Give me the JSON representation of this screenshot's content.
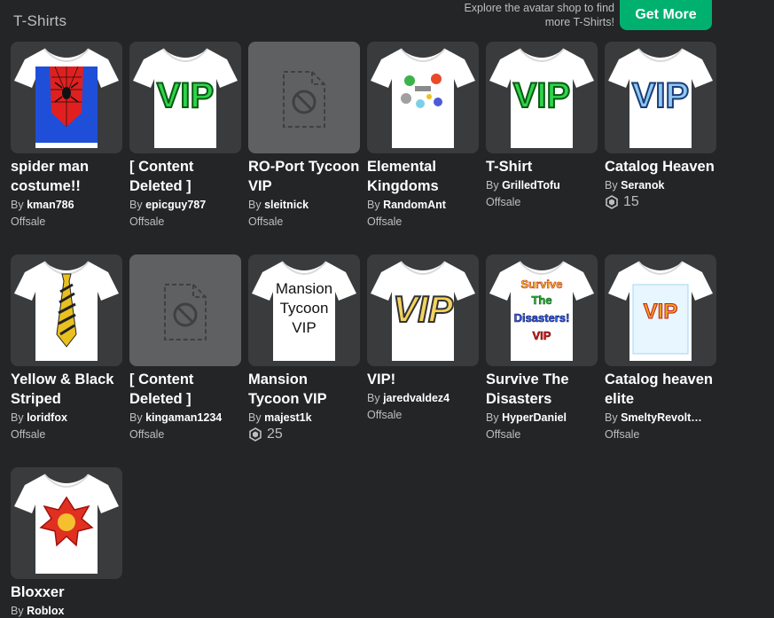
{
  "header": {
    "category_title": "T-Shirts",
    "promo_line1": "Explore the avatar shop to find",
    "promo_line2": "more T-Shirts!",
    "get_more_label": "Get More",
    "accent_color": "#00b06f"
  },
  "items": [
    {
      "name": "spider man costume!!",
      "by": "By",
      "creator": "kman786",
      "price": "Offsale",
      "thumb": "spiderman-shirt"
    },
    {
      "name": "[ Content Deleted ]",
      "by": "By",
      "creator": "epicguy787",
      "price": "Offsale",
      "thumb": "vip-green-shirt"
    },
    {
      "name": "RO-Port Tycoon VIP",
      "by": "By",
      "creator": "sleitnick",
      "price": "Offsale",
      "thumb": "deleted-placeholder"
    },
    {
      "name": "Elemental Kingdoms",
      "by": "By",
      "creator": "RandomAnt",
      "price": "Offsale",
      "thumb": "elemental-shirt"
    },
    {
      "name": "T-Shirt",
      "by": "By",
      "creator": "GrilledTofu",
      "price": "Offsale",
      "thumb": "vip-green-shirt"
    },
    {
      "name": "Catalog Heaven",
      "by": "By",
      "creator": "Seranok",
      "price": "15",
      "price_type": "robux",
      "thumb": "vip-sky-shirt"
    },
    {
      "name": "Yellow & Black Striped",
      "by": "By",
      "creator": "loridfox",
      "price": "Offsale",
      "thumb": "tie-shirt"
    },
    {
      "name": "[ Content Deleted ]",
      "by": "By",
      "creator": "kingaman1234",
      "price": "Offsale",
      "thumb": "deleted-placeholder"
    },
    {
      "name": "Mansion Tycoon VIP",
      "by": "By",
      "creator": "majest1k",
      "price": "25",
      "price_type": "robux",
      "thumb": "mansion-shirt"
    },
    {
      "name": "VIP!",
      "by": "By",
      "creator": "jaredvaldez4",
      "price": "Offsale",
      "thumb": "vip-gold-shirt"
    },
    {
      "name": "Survive The Disasters",
      "by": "By",
      "creator": "HyperDaniel",
      "price": "Offsale",
      "thumb": "disasters-shirt"
    },
    {
      "name": "Catalog heaven elite",
      "by": "By",
      "creator": "SmeltyRevolt…",
      "price": "Offsale",
      "thumb": "vip-elite-shirt"
    },
    {
      "name": "Bloxxer",
      "by": "By",
      "creator": "Roblox",
      "price": "",
      "thumb": "bloxxer-shirt"
    }
  ],
  "thumb_text": {
    "vip": "VIP",
    "mansion_line1": "Mansion",
    "mansion_line2": "Tycoon",
    "mansion_line3": "VIP",
    "disasters_line1": "Survive",
    "disasters_line2": "The",
    "disasters_line3": "Disasters!",
    "disasters_line4": "VIP"
  }
}
